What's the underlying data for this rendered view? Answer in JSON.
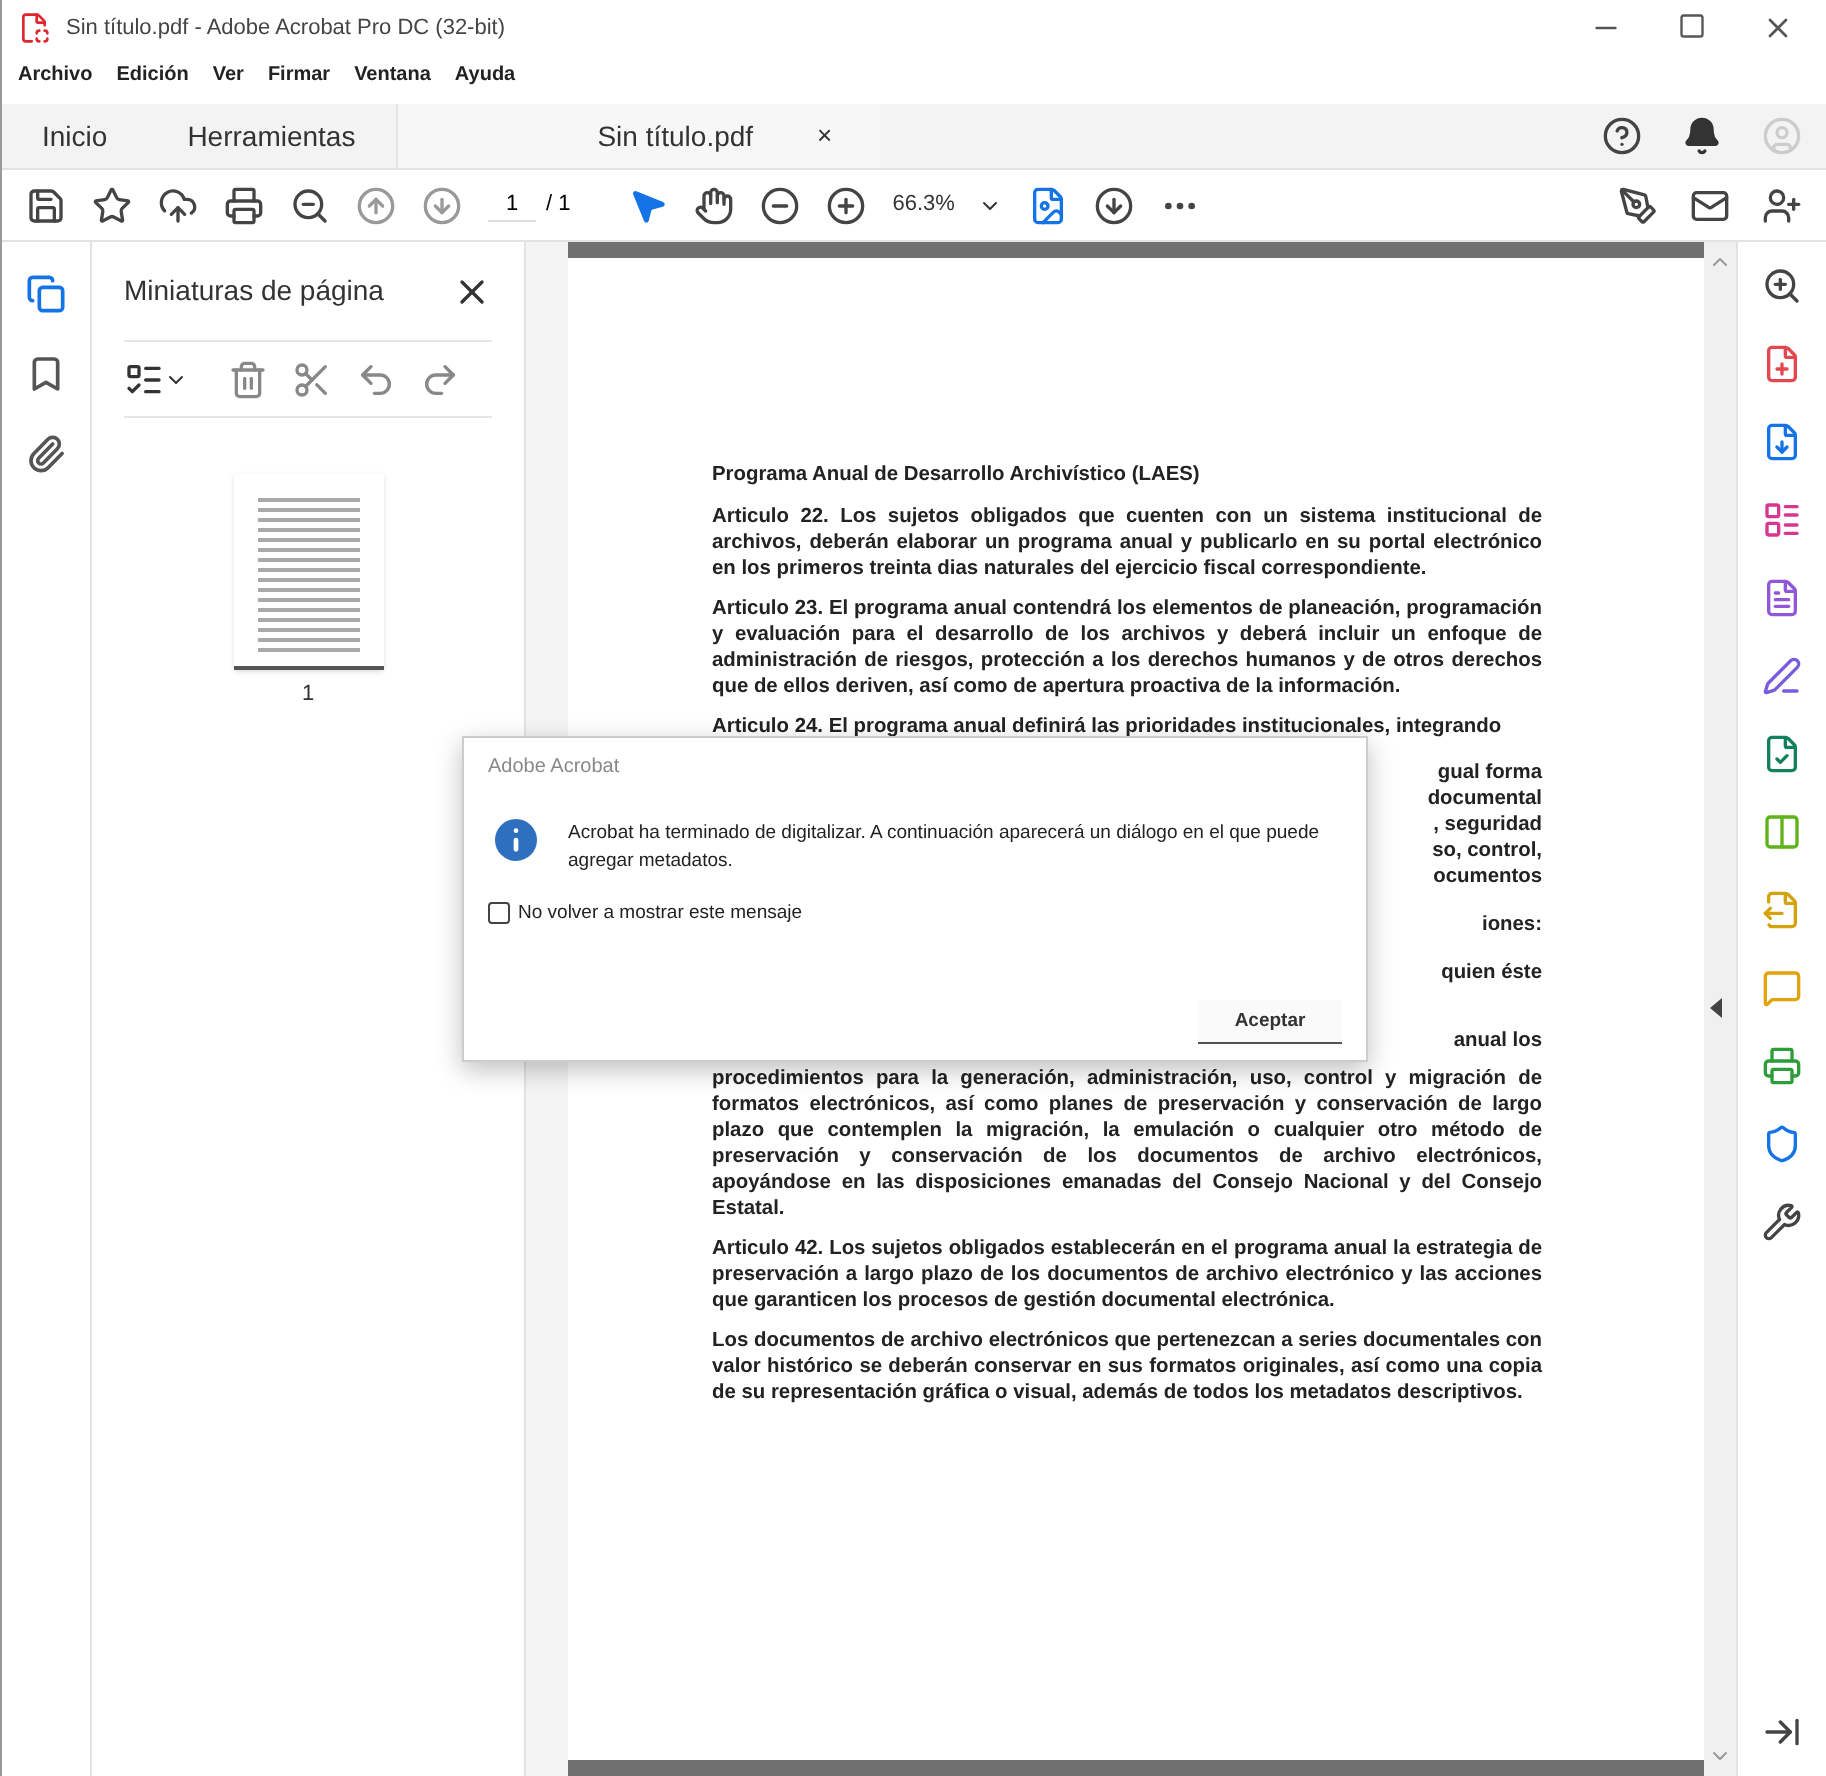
{
  "window": {
    "title": "Sin título.pdf - Adobe Acrobat Pro DC (32-bit)"
  },
  "menu": [
    "Archivo",
    "Edición",
    "Ver",
    "Firmar",
    "Ventana",
    "Ayuda"
  ],
  "tabs": [
    {
      "label": "Inicio",
      "selected": false,
      "kind": "nav"
    },
    {
      "label": "Herramientas",
      "selected": false,
      "kind": "nav"
    },
    {
      "label": "Sin título.pdf",
      "selected": true,
      "kind": "document",
      "close": "×"
    }
  ],
  "toolbar": {
    "page_current": "1",
    "page_total": "/ 1",
    "zoom": "66.3%"
  },
  "side_nav": [
    {
      "kind": "pages",
      "selected": true
    },
    {
      "kind": "bookmarks",
      "selected": false
    },
    {
      "kind": "attachments",
      "selected": false
    }
  ],
  "thumbnails_panel": {
    "title": "Miniaturas de página",
    "pages": [
      {
        "label": "1",
        "selected": true
      }
    ]
  },
  "document": {
    "heading": "Programa Anual de Desarrollo Archivístico (LAES)",
    "paragraphs": [
      "**Articulo 22**. Los sujetos obligados que cuenten con un sistema institucional de archivos, deberán elaborar un programa anual y publicarlo en su portal electrónico en los primeros treinta dias naturales del ejercicio fiscal correspondiente.",
      "**Articulo 23**. El programa anual contendrá los elementos de planeación, programación y evaluación para el desarrollo de los archivos y deberá incluir un enfoque de administración de riesgos, protección a los derechos humanos y de otros derechos que de ellos deriven, así como de apertura proactiva de la información."
    ],
    "partial_line": "**Articulo 24**. El programa anual definirá las prioridades institucionales, integrando",
    "fragment_blocks": [
      [
        "gual forma",
        "documental",
        ", seguridad",
        "so, control,",
        "ocumentos"
      ],
      [
        "iones:"
      ],
      [
        "quien éste"
      ]
    ],
    "continued_line": "anual los",
    "paragraphs_after": [
      "procedimientos para la generación, administración, uso, control y migración de formatos electrónicos, así como planes de preservación y conservación de largo plazo que contemplen la migración, la emulación o cualquier otro método de preservación y conservación de los documentos de archivo electrónicos, apoyándose en las disposiciones emanadas del Consejo Nacional y del Consejo Estatal.",
      "**Articulo 42**. Los sujetos obligados establecerán en el programa anual la estrategia de preservación a largo plazo de los documentos de archivo electrónico y las acciones que garanticen los procesos de gestión documental electrónica.",
      "Los documentos de archivo electrónicos que pertenezcan a series documentales con valor histórico se deberán conservar en sus formatos originales, así como una copia de su representación gráfica o visual, además de todos los metadatos descriptivos."
    ]
  },
  "dialog": {
    "title": "Adobe Acrobat",
    "message": "Acrobat ha terminado de digitalizar. A continuación aparecerá un diálogo en el que puede agregar metadatos.",
    "checkbox": {
      "label": "No volver a mostrar este mensaje",
      "checked": false
    },
    "button": "Aceptar"
  }
}
